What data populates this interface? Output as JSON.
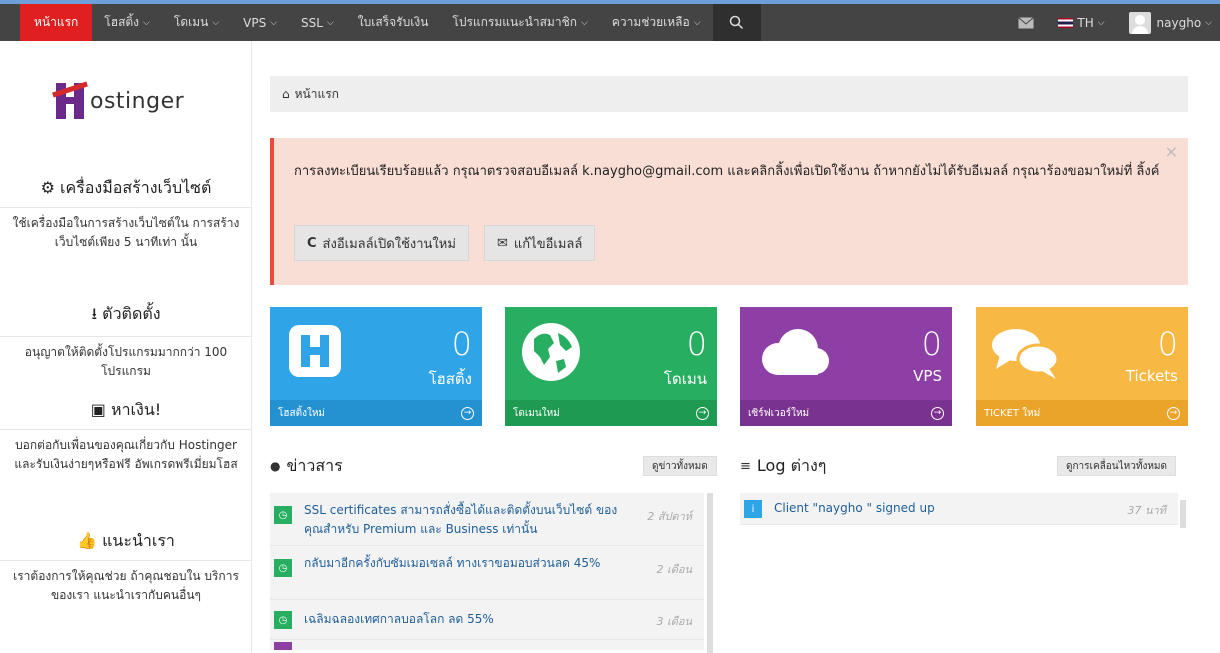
{
  "nav": {
    "items": [
      {
        "label": "หน้าแรก",
        "chevron": false
      },
      {
        "label": "โฮสติ้ง",
        "chevron": true
      },
      {
        "label": "โดเมน",
        "chevron": true
      },
      {
        "label": "VPS",
        "chevron": true
      },
      {
        "label": "SSL",
        "chevron": true
      },
      {
        "label": "ใบเสร็จรับเงิน",
        "chevron": false
      },
      {
        "label": "โปรแกรมแนะนำสมาชิก",
        "chevron": true
      },
      {
        "label": "ความช่วยเหลือ",
        "chevron": true
      }
    ],
    "language": "TH",
    "username": "naygho"
  },
  "sidebar": {
    "logo_text": "ostinger",
    "sections": [
      {
        "icon": "gears-icon",
        "title": "เครื่องมือสร้างเว็บไซต์",
        "text": "ใช้เครื่องมือในการสร้างเว็บไซต์ใน การสร้างเว็บไซต์เพียง 5 นาทีเท่า นั้น"
      },
      {
        "icon": "download-icon",
        "title": "ตัวติดตั้ง",
        "text": "อนุญาตให้ติดตั้งโปรแกรมมากกว่า 100 โปรแกรม"
      },
      {
        "icon": "money-icon",
        "title": "หาเงิน!",
        "text": "บอกต่อกับเพื่อนของคุณเกี่ยวกับ Hostinger และรับเงินง่ายๆหรือฟรี อัพเกรดพรีเมี่ยมโฮส"
      },
      {
        "icon": "thumbs-up-icon",
        "title": "แนะนำเรา",
        "text": "เราต้องการให้คุณช่วย ถ้าคุณชอบใน บริการของเรา แนะนำเรากับคนอื่นๆ"
      }
    ]
  },
  "breadcrumb": "หน้าแรก",
  "alert": {
    "text": "การลงทะเบียนเรียบร้อยแล้ว กรุณาตรวจสอบอีเมลล์ k.naygho@gmail.com และคลิกลิ้งเพื่อเปิดใช้งาน ถ้าหากยังไม่ได้รับอีเมลล์ กรุณาร้องขอมาใหม่ที่ ลิ้งค์",
    "resend_label": "ส่งอีเมลล์เปิดใช้งานใหม่",
    "edit_label": "แก้ไขอีเมลล์",
    "close": "×"
  },
  "tiles": [
    {
      "count": "0",
      "label": "โฮสติ้ง",
      "footer": "โฮสติ้งใหม่",
      "color": "#2fa4e7",
      "footcolor": "#2492d0"
    },
    {
      "count": "0",
      "label": "โดเมน",
      "footer": "โดเมนใหม่",
      "color": "#27ae60",
      "footcolor": "#1f9a52"
    },
    {
      "count": "0",
      "label": "VPS",
      "footer": "เซิร์ฟเวอร์ใหม่",
      "color": "#8e3fa6",
      "footcolor": "#7a3290"
    },
    {
      "count": "0",
      "label": "Tickets",
      "footer": "TICKET ใหม่",
      "color": "#f7b844",
      "footcolor": "#eaa42a"
    }
  ],
  "news": {
    "title": "ข่าวสาร",
    "view_all": "ดูข่าวทั้งหมด",
    "items": [
      {
        "text": "SSL certificates สามารถสั่งซื้อได้และติดตั้งบนเว็บไซต์ ของคุณสำหรับ Premium และ Business เท่านั้น",
        "time": "2 สัปดาห์"
      },
      {
        "text": "กลับมาอีกครั้งกับซัมเมอเซลล์ ทางเราขอมอบส่วนลด 45%",
        "time": "2 เดือน"
      },
      {
        "text": "เฉลิมฉลองเทศกาลบอลโลก ลด 55%",
        "time": "3 เดือน"
      }
    ]
  },
  "log": {
    "title": "Log ต่างๆ",
    "view_all": "ดูการเคลื่อนไหวทั้งหมด",
    "items": [
      {
        "text": "Client \"naygho \" signed up",
        "time": "37 นาที"
      }
    ]
  }
}
